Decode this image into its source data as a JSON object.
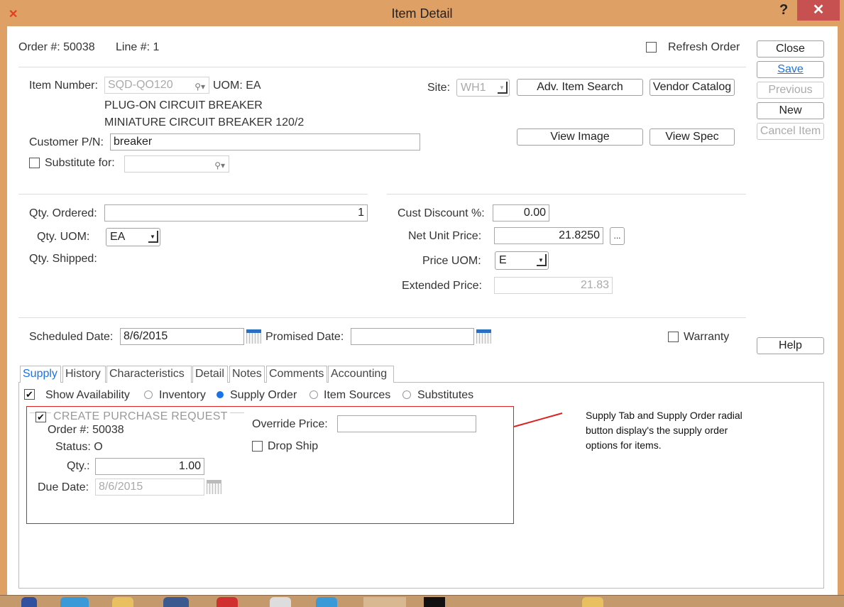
{
  "window": {
    "title": "Item Detail",
    "help_glyph": "?",
    "close_glyph": "✕"
  },
  "header": {
    "order_label": "Order #: 50038",
    "line_label": "Line #: 1",
    "refresh_label": "Refresh Order"
  },
  "side_buttons": {
    "close": "Close",
    "save": "Save",
    "previous": "Previous",
    "new": "New",
    "cancel_item": "Cancel Item",
    "help": "Help"
  },
  "item": {
    "item_number_label": "Item Number:",
    "item_number": "SQD-QO120",
    "uom": "UOM: EA",
    "desc1": "PLUG-ON CIRCUIT BREAKER",
    "desc2": "MINIATURE CIRCUIT BREAKER 120/2",
    "customer_pn_label": "Customer P/N:",
    "customer_pn": "breaker",
    "substitute_label": "Substitute for:",
    "substitute_value": "",
    "site_label": "Site:",
    "site": "WH1",
    "adv_search": "Adv. Item Search",
    "vendor_catalog": "Vendor Catalog",
    "view_image": "View Image",
    "view_spec": "View Spec"
  },
  "qty": {
    "ordered_label": "Qty. Ordered:",
    "ordered": "1",
    "uom_label": "Qty.  UOM:",
    "uom": "EA",
    "shipped_label": "Qty. Shipped:"
  },
  "price": {
    "discount_label": "Cust Discount %:",
    "discount": "0.00",
    "net_label": "Net Unit Price:",
    "net": "21.8250",
    "ellipsis": "...",
    "uom_label": "Price UOM:",
    "uom": "E",
    "ext_label": "Extended Price:",
    "ext": "21.83"
  },
  "dates": {
    "scheduled_label": "Scheduled Date:",
    "scheduled": "8/6/2015",
    "promised_label": "Promised Date:",
    "promised": "",
    "warranty_label": "Warranty"
  },
  "tabs": [
    "Supply",
    "History",
    "Characteristics",
    "Detail",
    "Notes",
    "Comments",
    "Accounting"
  ],
  "supply": {
    "show_availability": "Show Availability",
    "radios": [
      "Inventory",
      "Supply Order",
      "Item Sources",
      "Substitutes"
    ],
    "selected": "Supply Order",
    "create_pr": "CREATE PURCHASE REQUEST",
    "order": "Order #: 50038",
    "status": "Status: O",
    "qty_label": "Qty.:",
    "qty": "1.00",
    "due_label": "Due Date:",
    "due": "8/6/2015",
    "override_label": "Override Price:",
    "override": "",
    "drop_ship": "Drop Ship"
  },
  "annotation": {
    "text1": "Supply Tab and Supply Order radial",
    "text2": "button display's the supply order",
    "text3": "options for items.",
    "color": "#e02020"
  }
}
